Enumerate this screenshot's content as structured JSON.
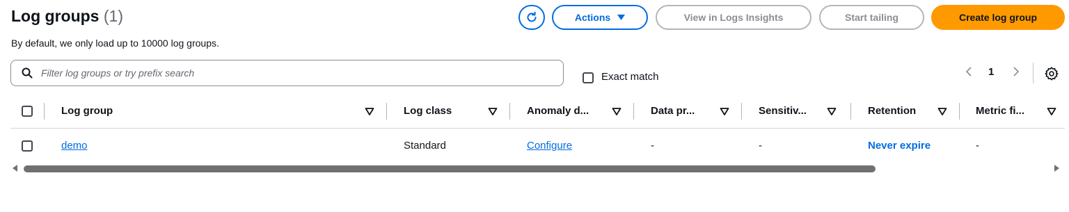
{
  "header": {
    "title": "Log groups",
    "count": "(1)",
    "subtitle": "By default, we only load up to 10000 log groups."
  },
  "toolbar": {
    "refresh_icon": "refresh-icon",
    "actions_label": "Actions",
    "insights_label": "View in Logs Insights",
    "tail_label": "Start tailing",
    "create_label": "Create log group"
  },
  "filter": {
    "placeholder": "Filter log groups or try prefix search",
    "value": "",
    "exact_match_label": "Exact match",
    "exact_match_checked": false
  },
  "pagination": {
    "current_page": "1"
  },
  "table": {
    "columns": [
      {
        "label": "Log group"
      },
      {
        "label": "Log class"
      },
      {
        "label": "Anomaly d..."
      },
      {
        "label": "Data pr..."
      },
      {
        "label": "Sensitiv..."
      },
      {
        "label": "Retention"
      },
      {
        "label": "Metric fi..."
      }
    ],
    "rows": [
      {
        "log_group": "demo",
        "log_class": "Standard",
        "anomaly_detection": "Configure",
        "data_protection": "-",
        "sensitive": "-",
        "retention": "Never expire",
        "metric_filters": "-"
      }
    ]
  },
  "colors": {
    "primary_blue": "#006ce0",
    "create_orange": "#ff9900",
    "disabled_border": "#b4b4bb"
  }
}
